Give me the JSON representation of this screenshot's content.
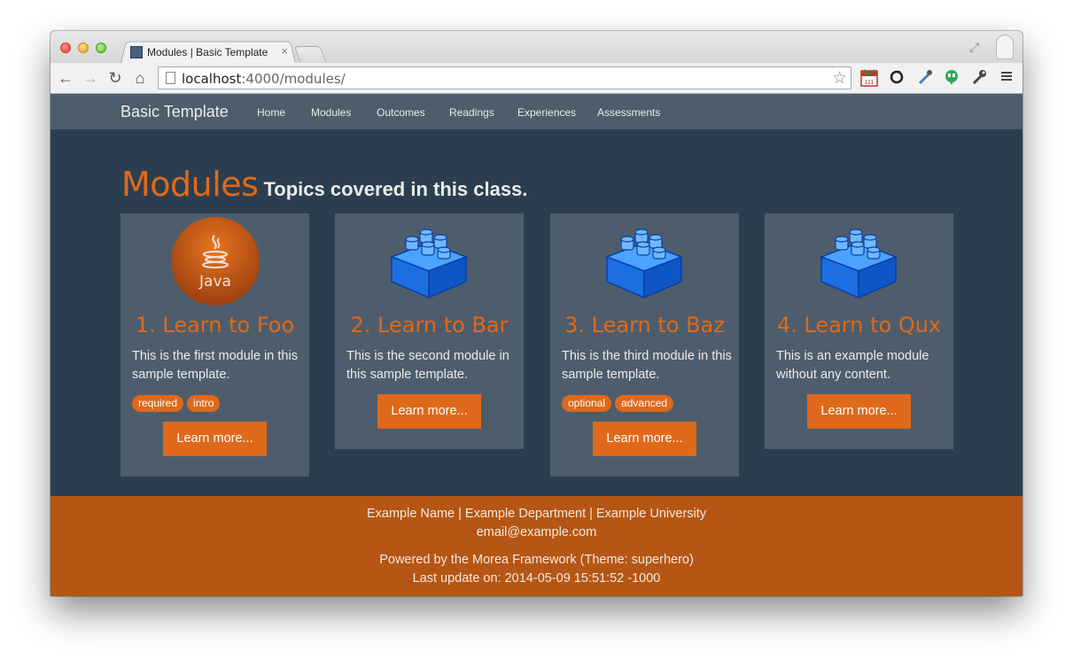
{
  "browser": {
    "tab_title": "Modules | Basic Template",
    "tab_close": "×",
    "url_host": "localhost",
    "url_rest": ":4000/modules/"
  },
  "nav": {
    "brand": "Basic Template",
    "links": [
      "Home",
      "Modules",
      "Outcomes",
      "Readings",
      "Experiences",
      "Assessments"
    ]
  },
  "header": {
    "title": "Modules",
    "subtitle": "Topics covered in this class."
  },
  "modules": [
    {
      "title": "1. Learn to Foo",
      "description": "This is the first module in this sample template.",
      "badges": [
        "required",
        "intro"
      ],
      "button": "Learn more...",
      "icon": "java-icon",
      "icon_text": "Java"
    },
    {
      "title": "2. Learn to Bar",
      "description": "This is the second module in this sample template.",
      "badges": [],
      "button": "Learn more...",
      "icon": "lego-block-icon"
    },
    {
      "title": "3. Learn to Baz",
      "description": "This is the third module in this sample template.",
      "badges": [
        "optional",
        "advanced"
      ],
      "button": "Learn more...",
      "icon": "lego-block-icon"
    },
    {
      "title": "4. Learn to Qux",
      "description": "This is an example module without any content.",
      "badges": [],
      "button": "Learn more...",
      "icon": "lego-block-icon"
    }
  ],
  "footer": {
    "line1": "Example Name | Example Department | Example University",
    "line2": "email@example.com",
    "line3": "Powered by the Morea Framework (Theme: superhero)",
    "line4": "Last update on: 2014-05-09 15:51:52 -1000"
  },
  "colors": {
    "accent": "#df691a",
    "page_bg": "#2b3e50",
    "card_bg": "#4e5d6c",
    "footer_bg": "#b55614"
  }
}
